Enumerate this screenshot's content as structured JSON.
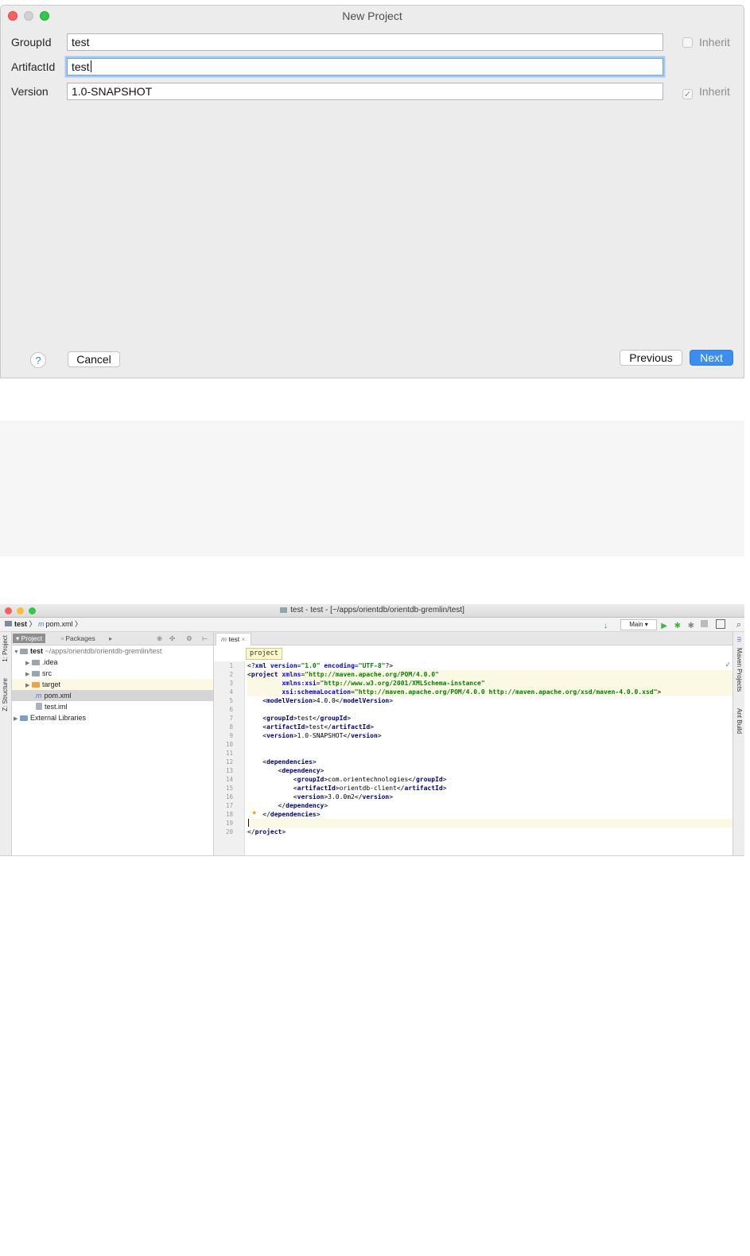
{
  "dialog": {
    "title": "New Project",
    "fields": [
      {
        "label": "GroupId",
        "value": "test",
        "inherit_label": "Inherit",
        "inherit_checked": false
      },
      {
        "label": "ArtifactId",
        "value": "test"
      },
      {
        "label": "Version",
        "value": "1.0-SNAPSHOT",
        "inherit_label": "Inherit",
        "inherit_checked": true
      }
    ],
    "help_label": "?",
    "cancel_label": "Cancel",
    "previous_label": "Previous",
    "next_label": "Next"
  },
  "ide": {
    "window_title": "test - test - [~/apps/orientdb/orientdb-gremlin/test]",
    "breadcrumb": [
      "test",
      "pom.xml"
    ],
    "run_config": "Main",
    "left_tools": [
      "1: Project",
      "Z: Structure"
    ],
    "right_tools": [
      "Maven Projects",
      "Ant Build"
    ],
    "project_tabs": [
      "Project",
      "Packages"
    ],
    "tree": [
      {
        "name": "test",
        "path": "~/apps/orientdb/orientdb-gremlin/test"
      },
      {
        "name": ".idea"
      },
      {
        "name": "src"
      },
      {
        "name": "target"
      },
      {
        "name": "pom.xml"
      },
      {
        "name": "test.iml"
      },
      {
        "name": "External Libraries"
      }
    ],
    "editor_tab": "test",
    "editor_breadcrumb": "project",
    "code_lines": [
      {
        "n": "1",
        "text": "<?xml version=\"1.0\" encoding=\"UTF-8\"?>"
      },
      {
        "n": "2",
        "text": "<project xmlns=\"http://maven.apache.org/POM/4.0.0\""
      },
      {
        "n": "3",
        "text": "         xmlns:xsi=\"http://www.w3.org/2001/XMLSchema-instance\""
      },
      {
        "n": "4",
        "text": "         xsi:schemaLocation=\"http://maven.apache.org/POM/4.0.0 http://maven.apache.org/xsd/maven-4.0.0.xsd\">"
      },
      {
        "n": "5",
        "text": "    <modelVersion>4.0.0</modelVersion>"
      },
      {
        "n": "6",
        "text": ""
      },
      {
        "n": "7",
        "text": "    <groupId>test</groupId>"
      },
      {
        "n": "8",
        "text": "    <artifactId>test</artifactId>"
      },
      {
        "n": "9",
        "text": "    <version>1.0-SNAPSHOT</version>"
      },
      {
        "n": "10",
        "text": ""
      },
      {
        "n": "11",
        "text": ""
      },
      {
        "n": "12",
        "text": "    <dependencies>"
      },
      {
        "n": "13",
        "text": "        <dependency>"
      },
      {
        "n": "14",
        "text": "            <groupId>com.orientechnologies</groupId>"
      },
      {
        "n": "15",
        "text": "            <artifactId>orientdb-client</artifactId>"
      },
      {
        "n": "16",
        "text": "            <version>3.0.0m2</version>"
      },
      {
        "n": "17",
        "text": "        </dependency>"
      },
      {
        "n": "18",
        "text": "    </dependencies>"
      },
      {
        "n": "19",
        "text": ""
      },
      {
        "n": "20",
        "text": "</project>"
      }
    ]
  }
}
